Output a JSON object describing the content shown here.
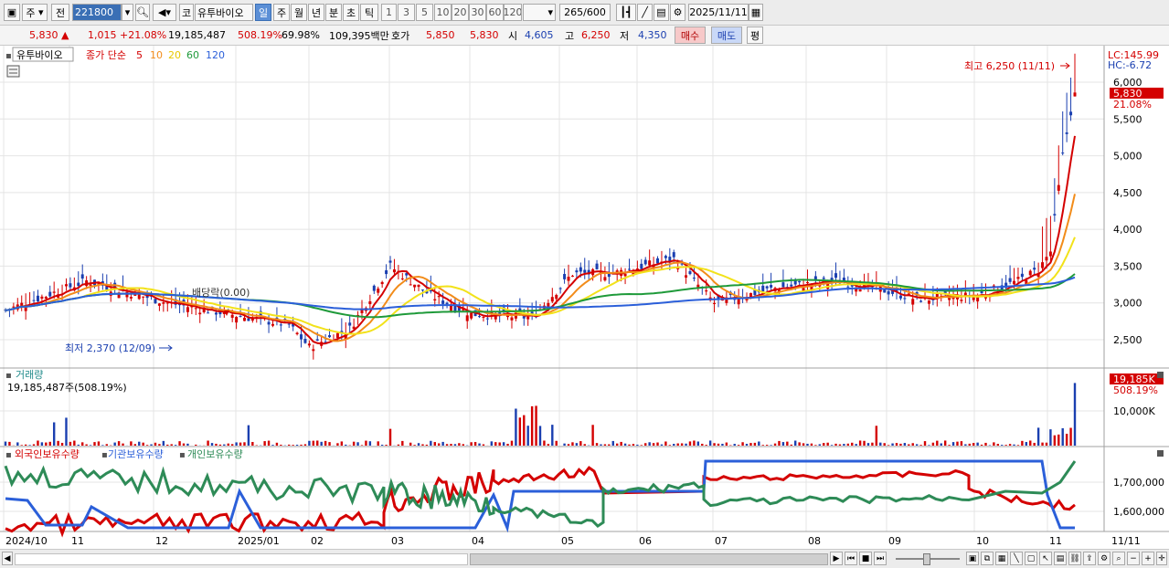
{
  "toolbar": {
    "type_select": "주",
    "prev_label": "전",
    "stock_code": "221800",
    "market_tag": "코",
    "stock_name": "유투바이오",
    "periods": [
      "일",
      "주",
      "월",
      "년",
      "분",
      "초",
      "틱"
    ],
    "active_period": "일",
    "intervals": [
      "1",
      "3",
      "5",
      "10",
      "20",
      "30",
      "60",
      "120"
    ],
    "count_value": "265",
    "count_total": "/600",
    "date_value": "2025/11/11"
  },
  "quote": {
    "price": "5,830",
    "change_arrow": "▲",
    "change": "1,015",
    "change_pct": "+21.08%",
    "volume": "19,185,487",
    "volume_ratio": "508.19%",
    "turnover": "69.98%",
    "amount": "109,395백만",
    "ask_label": "호가",
    "ask": "5,850",
    "bid": "5,830",
    "open_label": "시",
    "open": "4,605",
    "high_label": "고",
    "high": "6,250",
    "low_label": "저",
    "low": "4,350",
    "buy_label": "매수",
    "sell_label": "매도",
    "eval_label": "평"
  },
  "price_panel": {
    "stock_label": "유투바이오",
    "legend_prefix": "종가 단순",
    "ma_periods": [
      "5",
      "10",
      "20",
      "60",
      "120"
    ],
    "ma_colors": [
      "#d40000",
      "#f28c1a",
      "#f2e21a",
      "#1f9a3a",
      "#2b5fd9"
    ],
    "lc_label": "LC:145.99",
    "hc_label": "HC:-6.72",
    "y_ticks": [
      "6,000",
      "5,500",
      "5,000",
      "4,500",
      "4,000",
      "3,500",
      "3,000",
      "2,500"
    ],
    "current_price_tag": "5,830",
    "current_pct_tag": "21.08%",
    "high_annotation": "최고 6,250 (11/11)",
    "low_annotation": "최저 2,370 (12/09)",
    "dividend_annotation": "배당락(0.00)"
  },
  "volume_panel": {
    "title": "거래량",
    "value_label": "19,185,487주(508.19%)",
    "y_tick": "10,000K",
    "current_tag": "19,185K",
    "current_pct": "508.19%"
  },
  "holdings_panel": {
    "series_labels": [
      "외국인보유수량",
      "기관보유수량",
      "개인보유수량"
    ],
    "series_colors": [
      "#d40000",
      "#2b5fd9",
      "#2e8b57"
    ],
    "y_ticks": [
      "1,700,000",
      "1,600,000"
    ]
  },
  "x_axis": {
    "labels": [
      "2024/10",
      "11",
      "12",
      "2025/01",
      "02",
      "03",
      "04",
      "05",
      "06",
      "07",
      "08",
      "09",
      "10",
      "11"
    ],
    "right_label": "11/11"
  }
}
